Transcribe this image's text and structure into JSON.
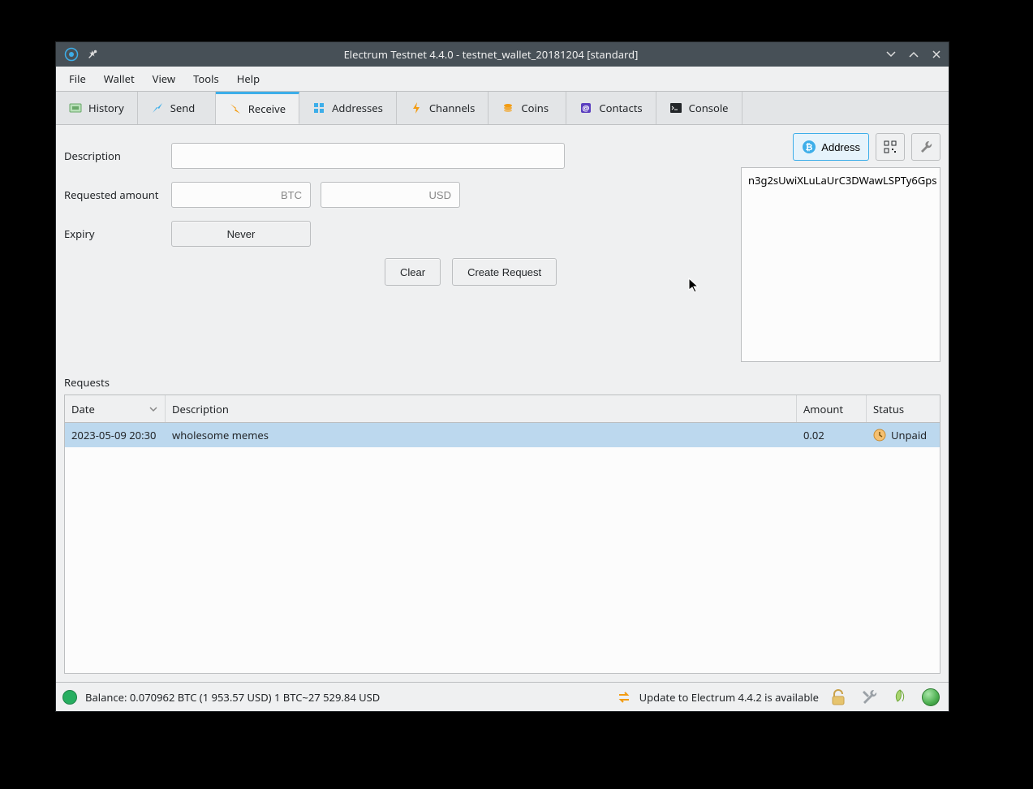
{
  "window": {
    "title": "Electrum Testnet 4.4.0 - testnet_wallet_20181204 [standard]"
  },
  "menubar": {
    "items": [
      "File",
      "Wallet",
      "View",
      "Tools",
      "Help"
    ]
  },
  "tabs": [
    {
      "label": "History",
      "active": false
    },
    {
      "label": "Send",
      "active": false
    },
    {
      "label": "Receive",
      "active": true
    },
    {
      "label": "Addresses",
      "active": false
    },
    {
      "label": "Channels",
      "active": false
    },
    {
      "label": "Coins",
      "active": false
    },
    {
      "label": "Contacts",
      "active": false
    },
    {
      "label": "Console",
      "active": false
    }
  ],
  "form": {
    "description_label": "Description",
    "description_value": "",
    "requested_amount_label": "Requested amount",
    "amount_btc_placeholder": "BTC",
    "amount_btc_value": "",
    "amount_usd_placeholder": "USD",
    "amount_usd_value": "",
    "expiry_label": "Expiry",
    "expiry_value": "Never",
    "clear_label": "Clear",
    "create_label": "Create Request"
  },
  "right_panel": {
    "address_button_label": "Address",
    "address_text": "n3g2sUwiXLuLaUrC3DWawLSPTy6Gps"
  },
  "requests": {
    "section_label": "Requests",
    "columns": {
      "date": "Date",
      "description": "Description",
      "amount": "Amount",
      "status": "Status"
    },
    "rows": [
      {
        "date": "2023-05-09 20:30",
        "description": "wholesome memes",
        "amount": "0.02",
        "status": "Unpaid",
        "selected": true
      }
    ]
  },
  "statusbar": {
    "balance_text": "Balance: 0.070962 BTC (1 953.57 USD)  1 BTC~27 529.84 USD",
    "update_text": "Update to Electrum 4.4.2 is available"
  }
}
